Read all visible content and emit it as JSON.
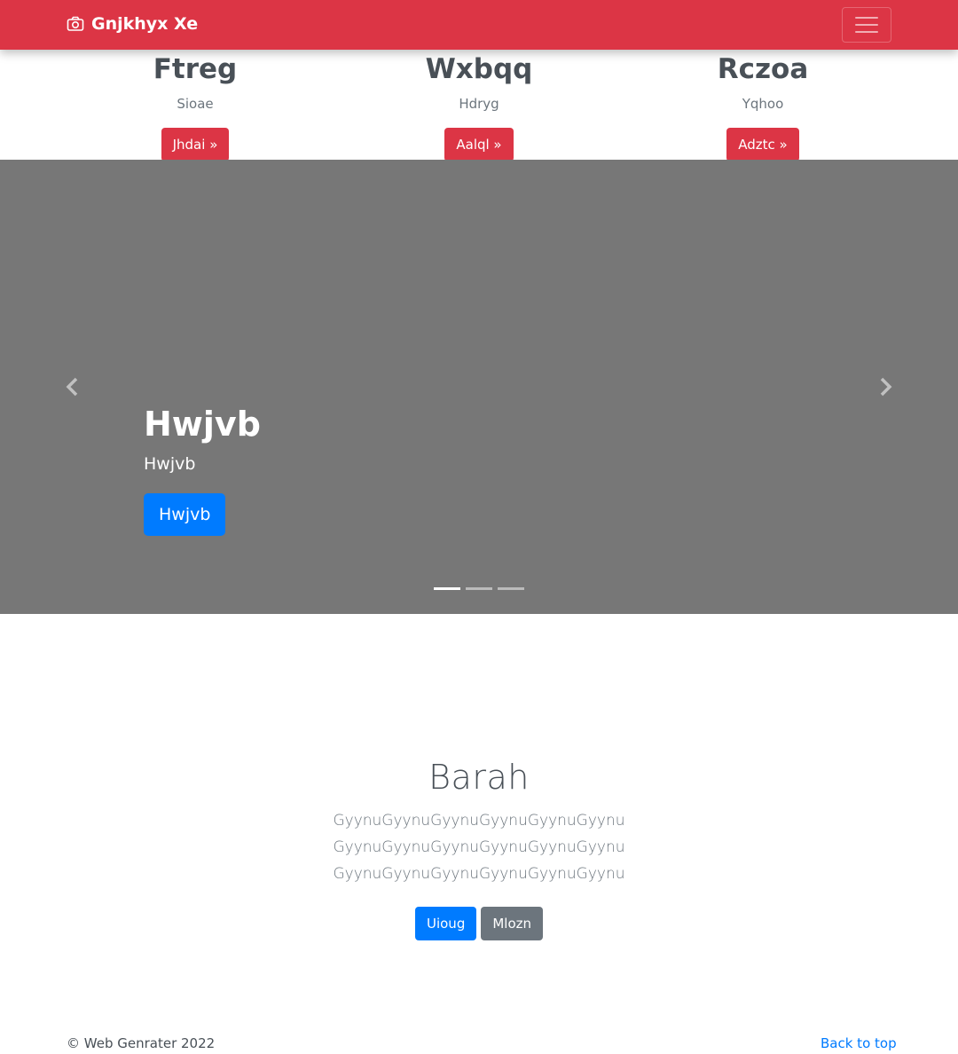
{
  "navbar": {
    "brand": "Gnjkhyx Xe",
    "brand_icon": "camera-icon",
    "toggler_icon": "hamburger-menu-icon",
    "color": "#dc3545"
  },
  "features": [
    {
      "title": "Ftreg",
      "subtitle": "Sioae",
      "button": "Jhdai »"
    },
    {
      "title": "Wxbqq",
      "subtitle": "Hdryg",
      "button": "Aalql »"
    },
    {
      "title": "Rczoa",
      "subtitle": "Yqhoo",
      "button": "Adztc »"
    }
  ],
  "carousel": {
    "title": "Hwjvb",
    "subtitle": "Hwjvb",
    "button": "Hwjvb",
    "background": "#777777",
    "prev_icon": "chevron-left-icon",
    "next_icon": "chevron-right-icon",
    "indicators": 3,
    "active_index": 0
  },
  "hero": {
    "title": "Barah",
    "lead_lines": [
      "GyynuGyynuGyynuGyynuGyynuGyynu",
      "GyynuGyynuGyynuGyynuGyynuGyynu",
      "GyynuGyynuGyynuGyynuGyynuGyynu"
    ],
    "primary_button": "Uioug",
    "secondary_button": "Mlozn"
  },
  "footer": {
    "copyright": "© Web Genrater 2022",
    "back_to_top": "Back to top"
  }
}
